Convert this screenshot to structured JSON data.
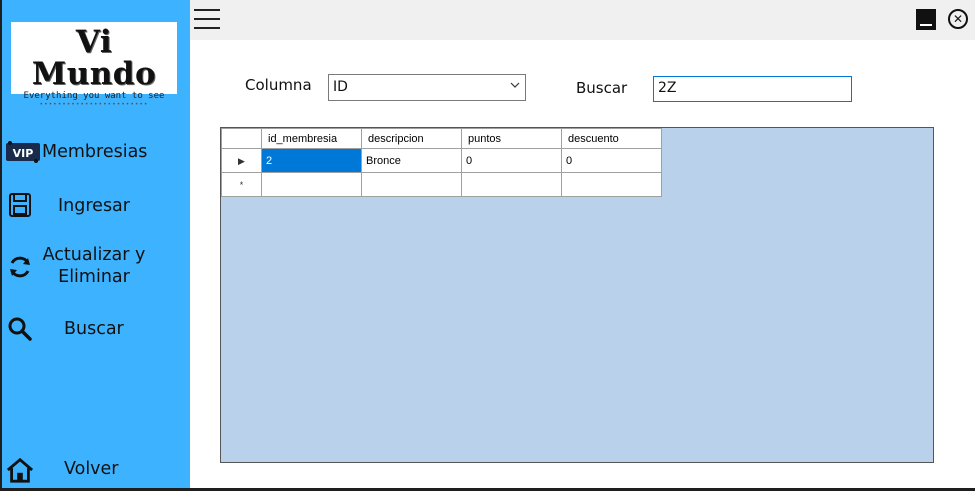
{
  "logo": {
    "title": "Vi Mundo",
    "subtitle": "Everything you want to see",
    "dots": "••••••••••••••••••••••••"
  },
  "sidebar": {
    "items": [
      {
        "label": "Membresias",
        "icon": "vip-icon"
      },
      {
        "label": "Ingresar",
        "icon": "floppy-disk-icon"
      },
      {
        "label": "Actualizar y Eliminar",
        "icon": "refresh-icon"
      },
      {
        "label": "Buscar",
        "icon": "search-icon"
      },
      {
        "label": "Volver",
        "icon": "home-icon"
      }
    ]
  },
  "toolbar": {
    "menu_icon": "hamburger-icon",
    "minimize_icon": "minimize-icon",
    "close_icon": "close-icon",
    "close_glyph": "✕"
  },
  "filter": {
    "column_label": "Columna",
    "column_value": "ID",
    "search_label": "Buscar",
    "search_value": "2Z"
  },
  "grid": {
    "columns": [
      "id_membresia",
      "descripcion",
      "puntos",
      "descuento"
    ],
    "rows": [
      {
        "marker": "▶",
        "cells": [
          "2",
          "Bronce",
          "0",
          "0"
        ]
      }
    ],
    "new_row_marker": "*"
  },
  "colors": {
    "sidebar": "#3db2ff",
    "grid_background": "#b9d1ea",
    "selection": "#0078d7"
  }
}
